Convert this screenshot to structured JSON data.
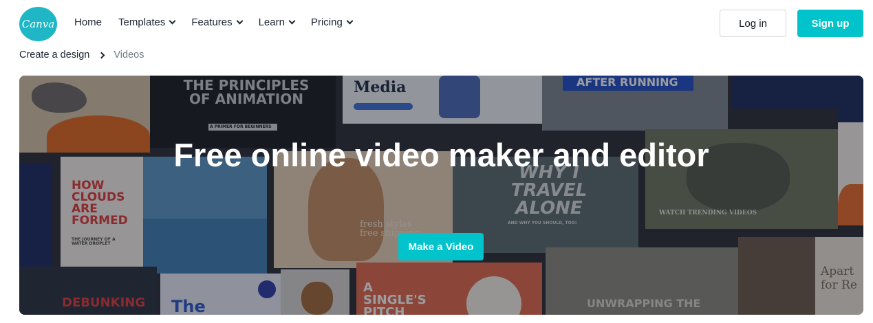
{
  "logo": {
    "text": "Canva"
  },
  "nav": {
    "items": [
      {
        "label": "Home",
        "has_dropdown": false
      },
      {
        "label": "Templates",
        "has_dropdown": true
      },
      {
        "label": "Features",
        "has_dropdown": true
      },
      {
        "label": "Learn",
        "has_dropdown": true
      },
      {
        "label": "Pricing",
        "has_dropdown": true
      }
    ]
  },
  "auth": {
    "login_label": "Log in",
    "signup_label": "Sign up"
  },
  "breadcrumb": {
    "parent": "Create a design",
    "current": "Videos"
  },
  "hero": {
    "title": "Free online video maker and editor",
    "cta_label": "Make a Video",
    "collage": {
      "animation_title": "THE PRINCIPLES OF ANIMATION",
      "animation_sub": "A PRIMER FOR BEGINNERS",
      "media": "Media",
      "running": "AFTER RUNNING",
      "clouds": "HOW CLOUDS ARE FORMED",
      "clouds_sub": "THE JOURNEY OF A WATER DROPLET",
      "fresh": "fresh styles free shipping",
      "travel": "WHY I TRAVEL ALONE",
      "travel_sub": "AND WHY YOU SHOULD, TOO!",
      "trending": "WATCH TRENDING VIDEOS",
      "apart": "Apart for Re",
      "debunking": "DEBUNKING",
      "the": "The",
      "pitch": "A SINGLE'S PITCH DECK",
      "unwrapping": "UNWRAPPING THE"
    }
  },
  "colors": {
    "brand": "#01c3cc",
    "logo": "#1fb6c6",
    "text": "#0e1318",
    "muted": "#737a80"
  }
}
